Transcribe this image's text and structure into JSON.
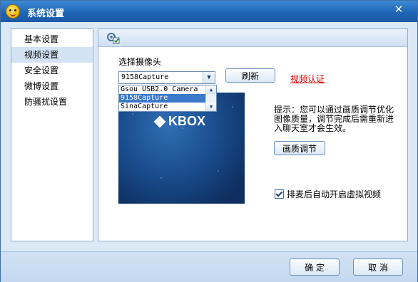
{
  "window": {
    "title": "系统设置",
    "close_glyph": "✕"
  },
  "sidebar": {
    "items": [
      {
        "label": "基本设置",
        "active": false
      },
      {
        "label": "视频设置",
        "active": true
      },
      {
        "label": "安全设置",
        "active": false
      },
      {
        "label": "微博设置",
        "active": false
      },
      {
        "label": "防骚扰设置",
        "active": false
      }
    ]
  },
  "video": {
    "select_camera_label": "选择摄像头",
    "selected_camera": "9158Capture",
    "camera_options": [
      "Gsou USB2.0 Camera",
      "9158Capture",
      "SinaCapture"
    ],
    "highlighted_option": "9158Capture",
    "refresh_button": "刷新",
    "verify_link": "视频认证",
    "preview_logo": "KBOX",
    "tip": "提示：您可以通过画质调节优化图像质量，调节完成后需重新进入聊天室才会生效。",
    "quality_button": "画质调节",
    "auto_virtual_checkbox": {
      "label": "排麦后自动开启虚拟视频",
      "checked": true
    }
  },
  "footer": {
    "ok_button": "确 定",
    "cancel_button": "取 消"
  },
  "colors": {
    "accent": "#1e63b4",
    "link": "#e00000"
  }
}
